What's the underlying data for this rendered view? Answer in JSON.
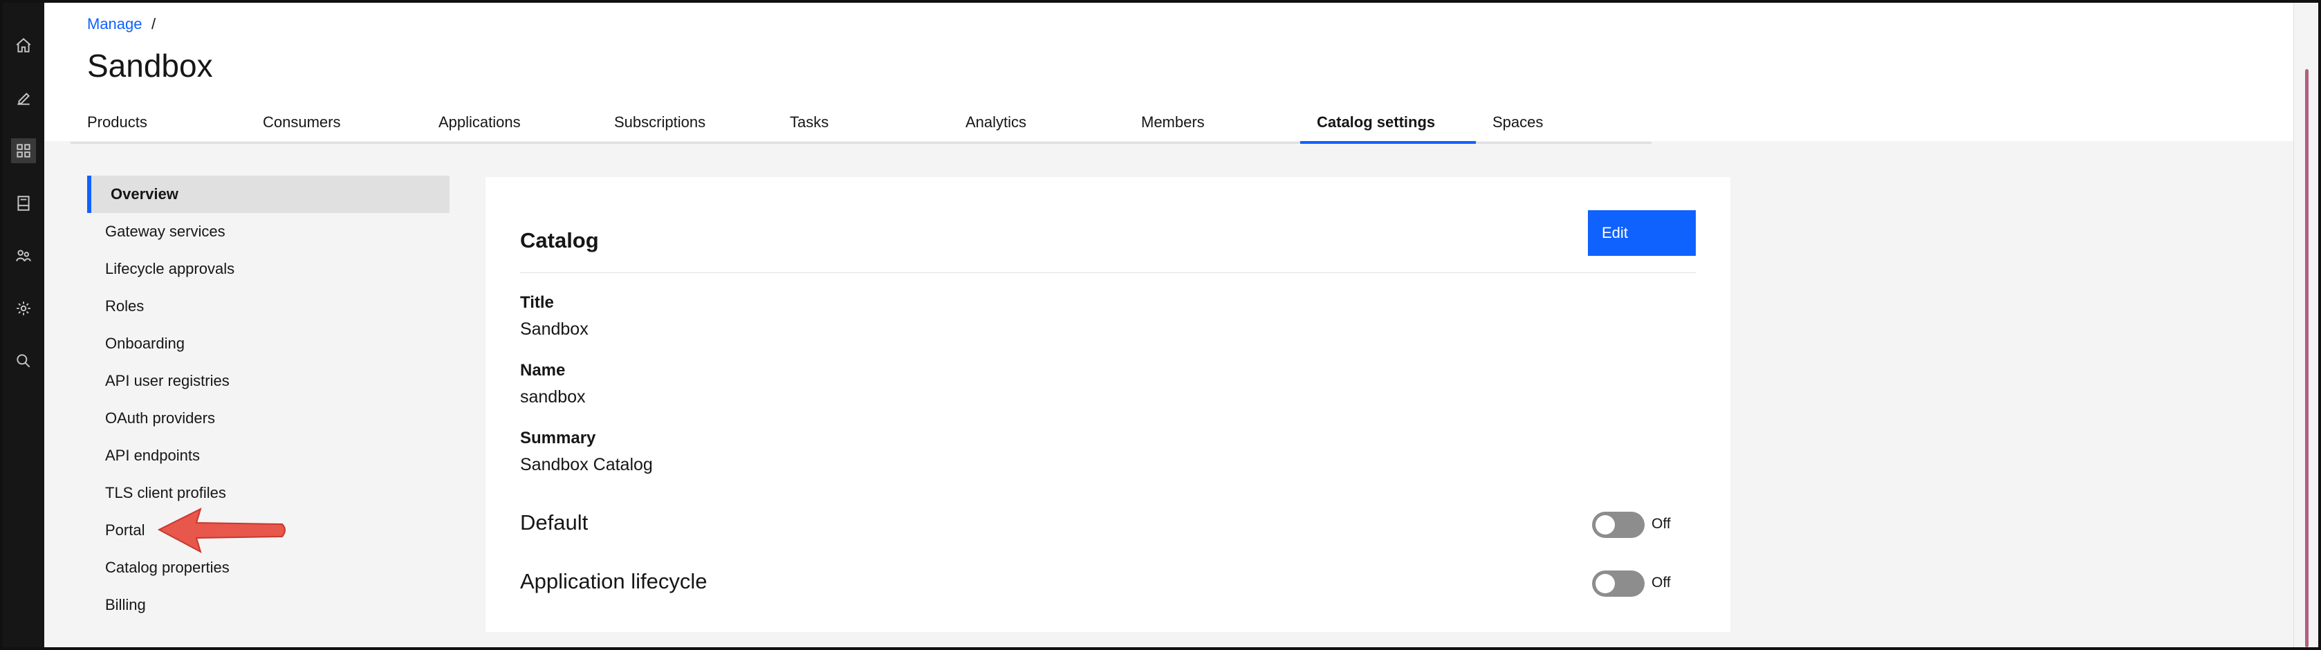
{
  "rail": {
    "icons": [
      "home-icon",
      "edit-icon",
      "dashboard-icon",
      "catalog-icon",
      "members-icon",
      "settings-icon",
      "search-icon"
    ]
  },
  "breadcrumb": {
    "link": "Manage",
    "separator": "/"
  },
  "page": {
    "title": "Sandbox"
  },
  "tabs": [
    {
      "label": "Products"
    },
    {
      "label": "Consumers"
    },
    {
      "label": "Applications"
    },
    {
      "label": "Subscriptions"
    },
    {
      "label": "Tasks"
    },
    {
      "label": "Analytics"
    },
    {
      "label": "Members"
    },
    {
      "label": "Catalog settings"
    },
    {
      "label": "Spaces"
    }
  ],
  "sidenav": {
    "items": [
      {
        "label": "Overview"
      },
      {
        "label": "Gateway services"
      },
      {
        "label": "Lifecycle approvals"
      },
      {
        "label": "Roles"
      },
      {
        "label": "Onboarding"
      },
      {
        "label": "API user registries"
      },
      {
        "label": "OAuth providers"
      },
      {
        "label": "API endpoints"
      },
      {
        "label": "TLS client profiles"
      },
      {
        "label": "Portal"
      },
      {
        "label": "Catalog properties"
      },
      {
        "label": "Billing"
      }
    ]
  },
  "card": {
    "title": "Catalog",
    "edit_label": "Edit",
    "fields": [
      {
        "label": "Title",
        "value": "Sandbox"
      },
      {
        "label": "Name",
        "value": "sandbox"
      },
      {
        "label": "Summary",
        "value": "Sandbox Catalog"
      }
    ],
    "toggles": [
      {
        "label": "Default",
        "state": "Off"
      },
      {
        "label": "Application lifecycle",
        "state": "Off"
      }
    ]
  },
  "colors": {
    "accent": "#0f62fe",
    "rail": "#161616",
    "arrow": "#e8574c"
  }
}
